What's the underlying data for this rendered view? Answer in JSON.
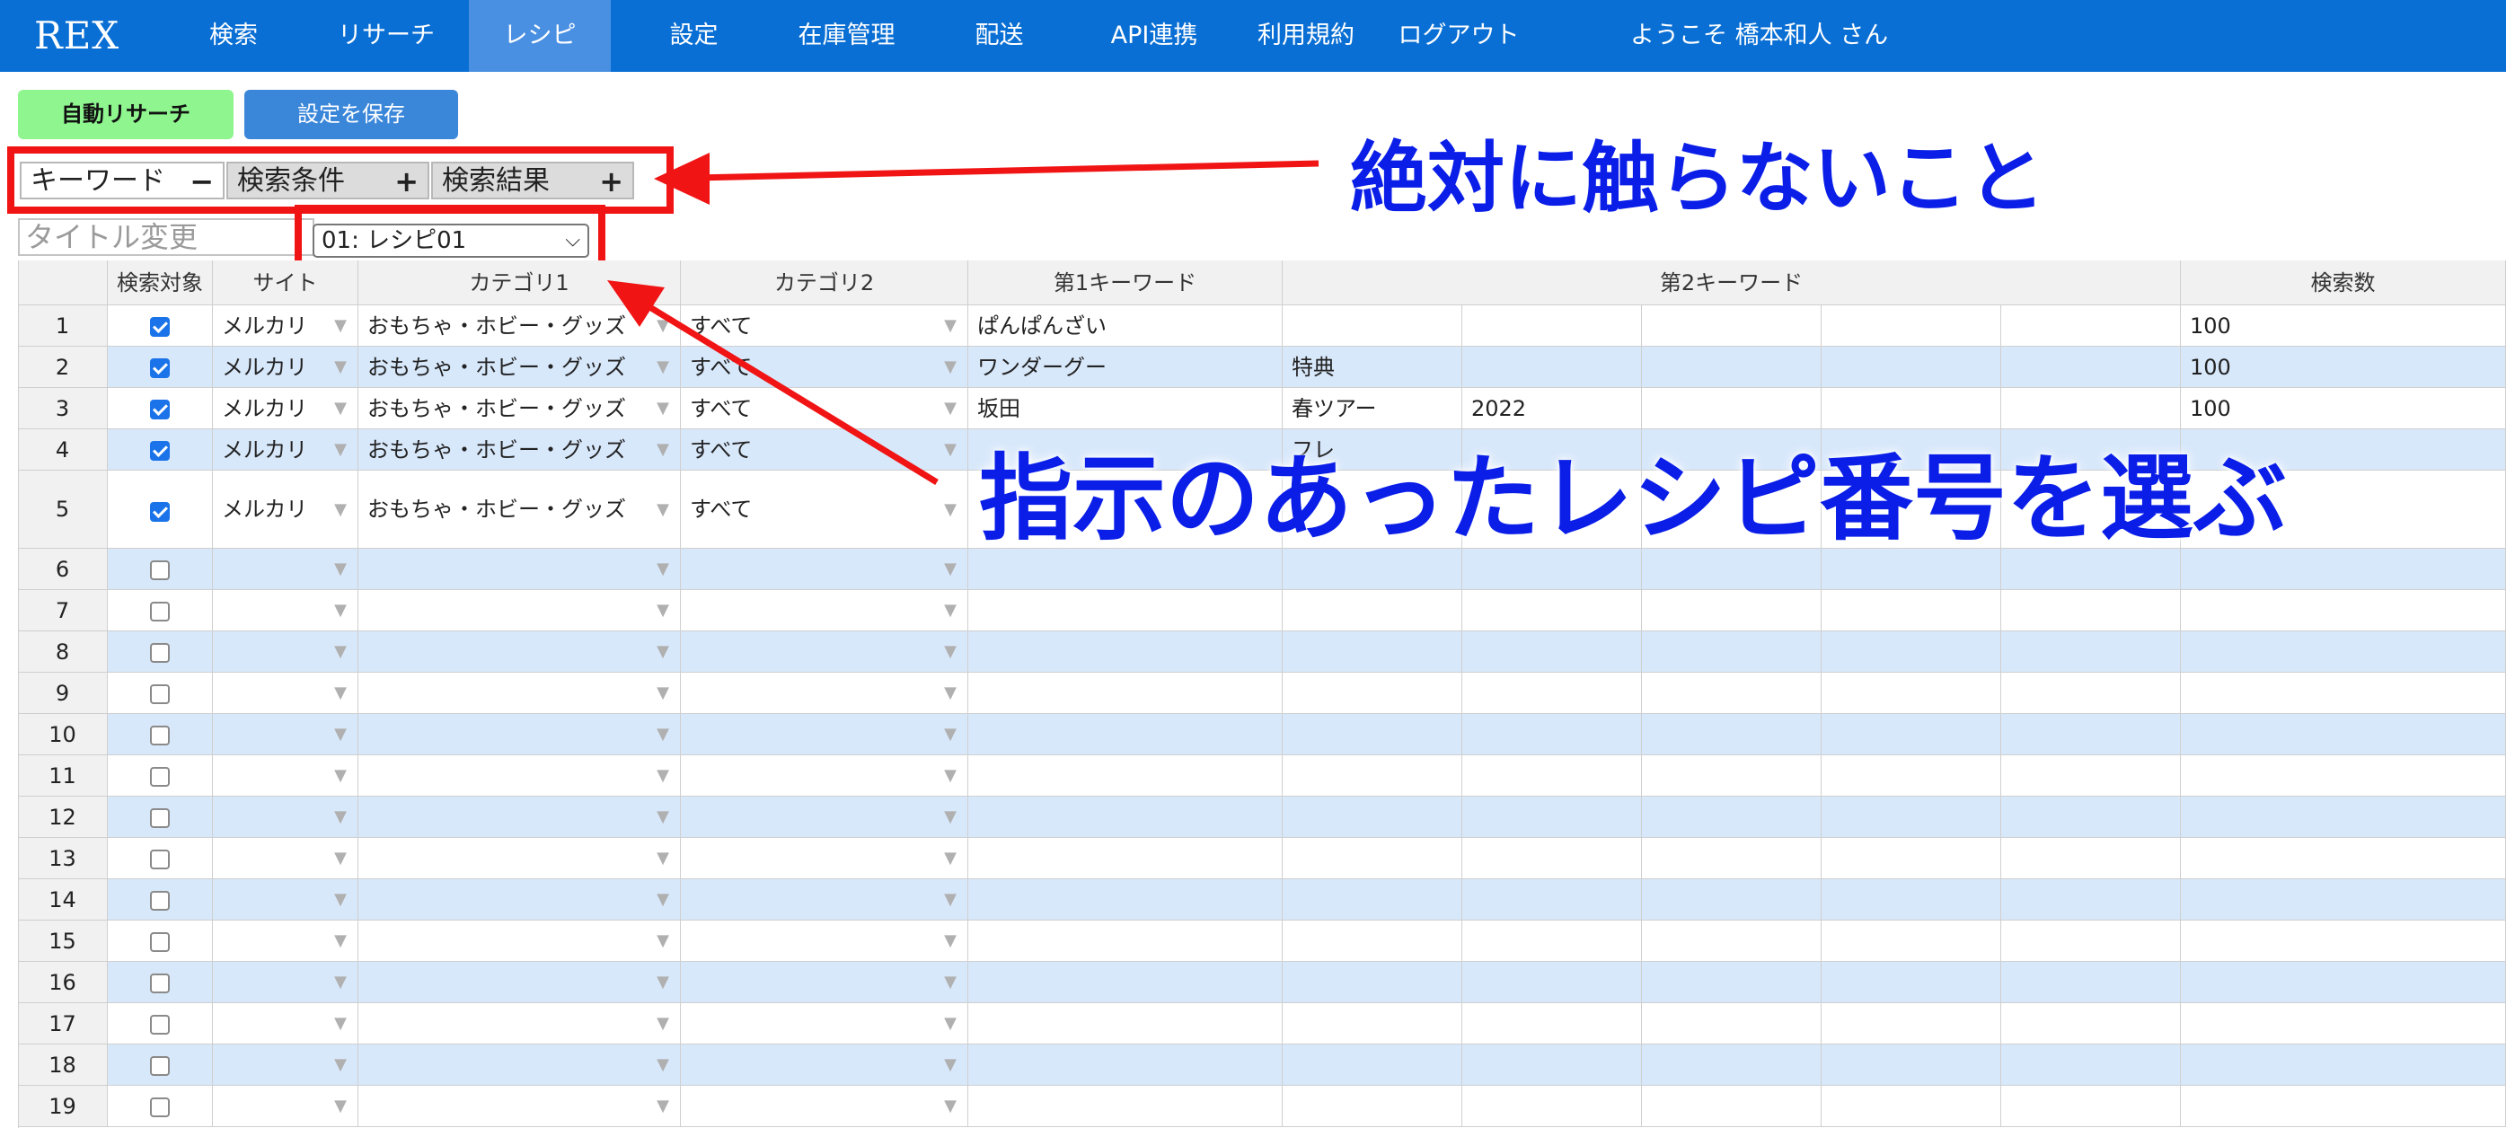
{
  "nav": {
    "brand": "REX",
    "items": [
      {
        "label": "検索"
      },
      {
        "label": "リサーチ"
      },
      {
        "label": "レシピ",
        "active": true
      },
      {
        "label": "設定"
      },
      {
        "label": "在庫管理"
      },
      {
        "label": "配送"
      },
      {
        "label": "API連携"
      },
      {
        "label": "利用規約"
      },
      {
        "label": "ログアウト"
      }
    ],
    "welcome": "ようこそ 橋本和人 さん"
  },
  "toolbar": {
    "auto_research_label": "自動リサーチ",
    "save_settings_label": "設定を保存"
  },
  "tabs": [
    {
      "label": "キーワード",
      "sign": "−"
    },
    {
      "label": "検索条件",
      "sign": "+"
    },
    {
      "label": "検索結果",
      "sign": "+"
    }
  ],
  "title_input": {
    "placeholder": "タイトル変更"
  },
  "recipe_select": {
    "value": "01: レシピ01"
  },
  "table": {
    "headers": [
      "",
      "検索対象",
      "サイト",
      "カテゴリ1",
      "カテゴリ2",
      "第1キーワード",
      "第2キーワード",
      "検索数"
    ],
    "rows": [
      {
        "num": "1",
        "checked": true,
        "site": "メルカリ",
        "cat1": "おもちゃ・ホビー・グッズ",
        "cat2": "すべて",
        "kw1": "ぱんぱんざい",
        "kw2": [
          "",
          "",
          "",
          "",
          ""
        ],
        "count": "100"
      },
      {
        "num": "2",
        "checked": true,
        "site": "メルカリ",
        "cat1": "おもちゃ・ホビー・グッズ",
        "cat2": "すべて",
        "kw1": "ワンダーグー",
        "kw2": [
          "特典",
          "",
          "",
          "",
          ""
        ],
        "count": "100"
      },
      {
        "num": "3",
        "checked": true,
        "site": "メルカリ",
        "cat1": "おもちゃ・ホビー・グッズ",
        "cat2": "すべて",
        "kw1": "坂田",
        "kw2": [
          "春ツアー",
          "2022",
          "",
          "",
          ""
        ],
        "count": "100"
      },
      {
        "num": "4",
        "checked": true,
        "site": "メルカリ",
        "cat1": "おもちゃ・ホビー・グッズ",
        "cat2": "すべて",
        "kw1": "",
        "kw2": [
          "フレ",
          "",
          "",
          "",
          ""
        ],
        "count": ""
      },
      {
        "num": "5",
        "checked": true,
        "site": "メルカリ",
        "cat1": "おもちゃ・ホビー・グッズ",
        "cat2": "すべて",
        "kw1": "",
        "kw2": [
          "",
          "",
          "",
          "",
          ""
        ],
        "count": ""
      },
      {
        "num": "6",
        "checked": false,
        "site": "",
        "cat1": "",
        "cat2": "",
        "kw1": "",
        "kw2": [
          "",
          "",
          "",
          "",
          ""
        ],
        "count": ""
      },
      {
        "num": "7",
        "checked": false,
        "site": "",
        "cat1": "",
        "cat2": "",
        "kw1": "",
        "kw2": [
          "",
          "",
          "",
          "",
          ""
        ],
        "count": ""
      },
      {
        "num": "8",
        "checked": false,
        "site": "",
        "cat1": "",
        "cat2": "",
        "kw1": "",
        "kw2": [
          "",
          "",
          "",
          "",
          ""
        ],
        "count": ""
      },
      {
        "num": "9",
        "checked": false,
        "site": "",
        "cat1": "",
        "cat2": "",
        "kw1": "",
        "kw2": [
          "",
          "",
          "",
          "",
          ""
        ],
        "count": ""
      },
      {
        "num": "10",
        "checked": false,
        "site": "",
        "cat1": "",
        "cat2": "",
        "kw1": "",
        "kw2": [
          "",
          "",
          "",
          "",
          ""
        ],
        "count": ""
      },
      {
        "num": "11",
        "checked": false,
        "site": "",
        "cat1": "",
        "cat2": "",
        "kw1": "",
        "kw2": [
          "",
          "",
          "",
          "",
          ""
        ],
        "count": ""
      },
      {
        "num": "12",
        "checked": false,
        "site": "",
        "cat1": "",
        "cat2": "",
        "kw1": "",
        "kw2": [
          "",
          "",
          "",
          "",
          ""
        ],
        "count": ""
      },
      {
        "num": "13",
        "checked": false,
        "site": "",
        "cat1": "",
        "cat2": "",
        "kw1": "",
        "kw2": [
          "",
          "",
          "",
          "",
          ""
        ],
        "count": ""
      },
      {
        "num": "14",
        "checked": false,
        "site": "",
        "cat1": "",
        "cat2": "",
        "kw1": "",
        "kw2": [
          "",
          "",
          "",
          "",
          ""
        ],
        "count": ""
      },
      {
        "num": "15",
        "checked": false,
        "site": "",
        "cat1": "",
        "cat2": "",
        "kw1": "",
        "kw2": [
          "",
          "",
          "",
          "",
          ""
        ],
        "count": ""
      },
      {
        "num": "16",
        "checked": false,
        "site": "",
        "cat1": "",
        "cat2": "",
        "kw1": "",
        "kw2": [
          "",
          "",
          "",
          "",
          ""
        ],
        "count": ""
      },
      {
        "num": "17",
        "checked": false,
        "site": "",
        "cat1": "",
        "cat2": "",
        "kw1": "",
        "kw2": [
          "",
          "",
          "",
          "",
          ""
        ],
        "count": ""
      },
      {
        "num": "18",
        "checked": false,
        "site": "",
        "cat1": "",
        "cat2": "",
        "kw1": "",
        "kw2": [
          "",
          "",
          "",
          "",
          ""
        ],
        "count": ""
      },
      {
        "num": "19",
        "checked": false,
        "site": "",
        "cat1": "",
        "cat2": "",
        "kw1": "",
        "kw2": [
          "",
          "",
          "",
          "",
          ""
        ],
        "count": ""
      }
    ]
  },
  "annotations": {
    "do_not_touch": "絶対に触らないこと",
    "select_recipe": "指示のあったレシピ番号を選ぶ",
    "box_color": "#f01414",
    "text_color": "#0a1ee8"
  },
  "colors": {
    "nav_bg": "#0a6fd4",
    "nav_active": "#4a90e2",
    "auto_btn": "#8ff58f",
    "save_btn": "#3a86d9",
    "alt_row": "#d8e8fb",
    "checkbox_on": "#1a73e8"
  }
}
